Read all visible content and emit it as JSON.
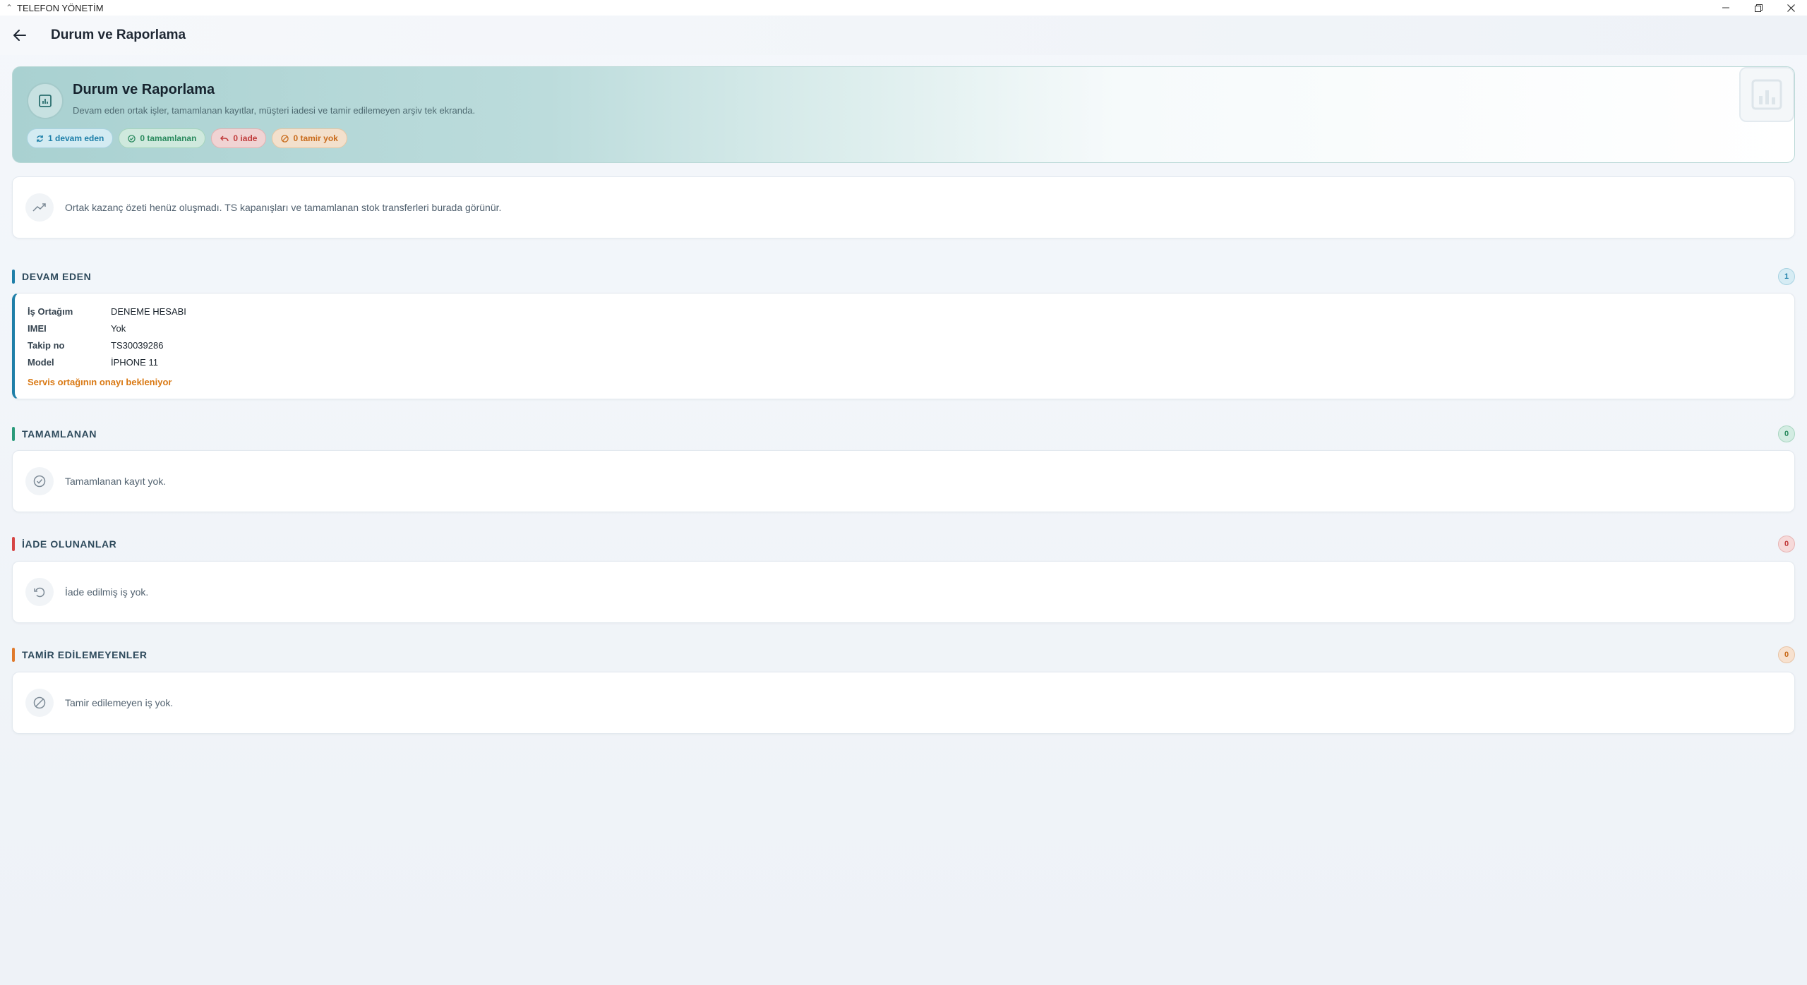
{
  "window": {
    "title": "TELEFON YÖNETİM",
    "controls": {
      "minimize": "—",
      "restore": "❐",
      "close": "✕"
    }
  },
  "header": {
    "title": "Durum ve Raporlama"
  },
  "hero": {
    "title": "Durum ve Raporlama",
    "subtitle": "Devam eden ortak işler, tamamlanan kayıtlar, müşteri iadesi ve tamir edilemeyen arşiv tek ekranda.",
    "chips": [
      {
        "label": "1 devam eden",
        "color": "#1c7ea8"
      },
      {
        "label": "0 tamamlanan",
        "color": "#2a8a5e"
      },
      {
        "label": "0 iade",
        "color": "#c03a3a"
      },
      {
        "label": "0 tamir yok",
        "color": "#c86a1a"
      }
    ]
  },
  "summary": {
    "text": "Ortak kazanç özeti henüz oluşmadı. TS kapanışları ve tamamlanan stok transferleri burada görünür."
  },
  "sections": {
    "ongoing": {
      "title": "DEVAM EDEN",
      "count": "1",
      "color": "#1f7fa8",
      "job": {
        "fields": [
          {
            "key": "İş Ortağım",
            "value": "DENEME HESABI"
          },
          {
            "key": "IMEI",
            "value": "Yok"
          },
          {
            "key": "Takip no",
            "value": "TS30039286"
          },
          {
            "key": "Model",
            "value": "İPHONE 11"
          }
        ],
        "status": "Servis ortağının onayı bekleniyor"
      }
    },
    "completed": {
      "title": "TAMAMLANAN",
      "count": "0",
      "color": "#2a9a7a",
      "empty": "Tamamlanan kayıt yok."
    },
    "returned": {
      "title": "İADE OLUNANLAR",
      "count": "0",
      "color": "#d64545",
      "empty": "İade edilmiş iş yok."
    },
    "unrepairable": {
      "title": "TAMİR EDİLEMEYENLER",
      "count": "0",
      "color": "#e07a2c",
      "empty": "Tamir edilemeyen iş yok."
    }
  }
}
